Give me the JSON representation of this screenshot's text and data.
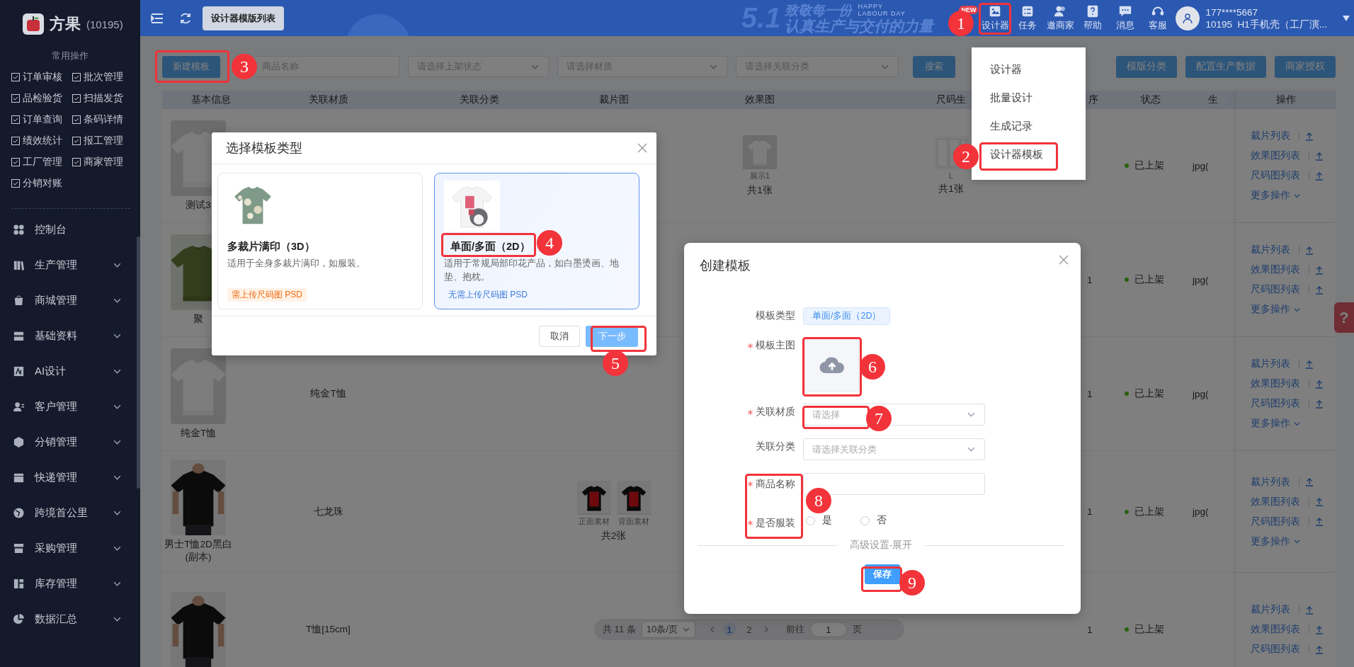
{
  "sidebar": {
    "logo_name": "方果",
    "account": "(10195)",
    "quick_title": "常用操作",
    "quick_links": [
      "订单审核",
      "批次管理",
      "品检验货",
      "扫描发货",
      "订单查询",
      "条码详情",
      "绩效统计",
      "报工管理",
      "工厂管理",
      "商家管理",
      "分销对账"
    ],
    "menu": [
      {
        "label": "控制台",
        "has_submenu": false
      },
      {
        "label": "生产管理",
        "has_submenu": true
      },
      {
        "label": "商城管理",
        "has_submenu": true
      },
      {
        "label": "基础资料",
        "has_submenu": true
      },
      {
        "label": "AI设计",
        "has_submenu": true
      },
      {
        "label": "客户管理",
        "has_submenu": true
      },
      {
        "label": "分销管理",
        "has_submenu": true
      },
      {
        "label": "快递管理",
        "has_submenu": true
      },
      {
        "label": "跨境首公里",
        "has_submenu": true
      },
      {
        "label": "采购管理",
        "has_submenu": true
      },
      {
        "label": "库存管理",
        "has_submenu": true
      },
      {
        "label": "数据汇总",
        "has_submenu": true
      }
    ]
  },
  "topbar": {
    "tab": "设计器模版列表",
    "banner": {
      "big": "5.1",
      "line_1": "致敬每一份",
      "tag_1": "HAPPY",
      "tag_2": "LABOUR DAY",
      "line_2": "认真生产与交付的力量"
    },
    "new_badge": "NEW",
    "nav": [
      "设计器",
      "任务",
      "邀商家",
      "帮助",
      "消息",
      "客服"
    ],
    "user": {
      "phone": "177****5667",
      "org": "10195  H1手机壳（工厂演..."
    }
  },
  "designer_menu": {
    "items": [
      "设计器",
      "批量设计",
      "生成记录",
      "设计器模板"
    ]
  },
  "toolbar": {
    "new_button": "新建模板",
    "search_placeholder": "商品名称",
    "filters": [
      "请选择上架状态",
      "请选择材质",
      "请选择关联分类"
    ],
    "search_button": "搜索",
    "actions": [
      "模版分类",
      "配置生产数据",
      "商家授权"
    ]
  },
  "table": {
    "columns": [
      "基本信息",
      "关联材质",
      "关联分类",
      "裁片图",
      "效果图",
      "尺码生",
      "序",
      "状态",
      "生"
    ],
    "ops_column": "操作",
    "rows": [
      {
        "name": "测试3",
        "effect": {
          "images": [
            "展示1"
          ],
          "total": "共1张"
        },
        "size": {
          "images": [
            "L"
          ],
          "total": "共1张"
        },
        "status": "已上架",
        "production": "jpg(",
        "ops": [
          "裁片列表",
          "效果图列表",
          "尺码图列表"
        ],
        "more": "更多操作"
      },
      {
        "name": "聚",
        "seq": "1",
        "status": "已上架",
        "production": "jpg(",
        "ops": [
          "裁片列表",
          "效果图列表",
          "尺码图列表"
        ],
        "more": "更多操作"
      },
      {
        "name": "纯金T恤",
        "material": "纯金T恤",
        "seq": "1",
        "status": "已上架",
        "production": "jpg(",
        "ops": [
          "裁片列表",
          "效果图列表",
          "尺码图列表"
        ],
        "more": "更多操作"
      },
      {
        "name": "男士T恤2D黑白(副本)",
        "material": "七龙珠",
        "cut": {
          "images": [
            "正面素材",
            "背面素材"
          ],
          "total": "共2张"
        },
        "seq": "1",
        "status": "已上架",
        "production": "jpg(",
        "ops": [
          "裁片列表",
          "效果图列表",
          "尺码图列表"
        ],
        "more": "更多操作"
      },
      {
        "material": "T恤[15cm]",
        "seq": "1",
        "status": "已上架",
        "ops": [
          "裁片列表",
          "效果图列表",
          "尺码图列表"
        ]
      }
    ]
  },
  "pagination": {
    "total": "共 11 条",
    "page_size": "10条/页",
    "pages": [
      {
        "label": "1",
        "selected": true
      },
      {
        "label": "2",
        "selected": false
      }
    ],
    "goto_label": "前往",
    "goto_value": "1",
    "goto_suffix": "页"
  },
  "help_tab": "?",
  "type_dialog": {
    "title": "选择模板类型",
    "cards": [
      {
        "title": "多裁片满印（3D）",
        "desc": "适用于全身多裁片满印，如服装。",
        "tag": "需上传尺码图 PSD",
        "selected": false
      },
      {
        "title": "单面/多面（2D）",
        "desc": "适用于常规局部印花产品，如白墨烫画、地垫、抱枕。",
        "tag": "无需上传尺码图 PSD",
        "selected": true
      }
    ],
    "cancel": "取消",
    "next": "下一步"
  },
  "create_dialog": {
    "title": "创建模板",
    "fields": [
      {
        "kind": "tag",
        "label": "模板类型",
        "required": false,
        "value": "单面/多面（2D）"
      },
      {
        "kind": "upload",
        "label": "模板主图",
        "required": true
      },
      {
        "kind": "select",
        "label": "关联材质",
        "required": true,
        "placeholder": "请选择"
      },
      {
        "kind": "select",
        "label": "关联分类",
        "required": false,
        "placeholder": "请选择关联分类"
      },
      {
        "kind": "input",
        "label": "商品名称",
        "required": true
      },
      {
        "kind": "radio",
        "label": "是否服装",
        "required": true,
        "options": [
          {
            "label": "是",
            "selected": false
          },
          {
            "label": "否",
            "selected": false
          }
        ]
      }
    ],
    "advanced": "高级设置-展开",
    "save": "保存"
  },
  "annotations": [
    "1",
    "2",
    "3",
    "4",
    "5",
    "6",
    "7",
    "8",
    "9"
  ]
}
